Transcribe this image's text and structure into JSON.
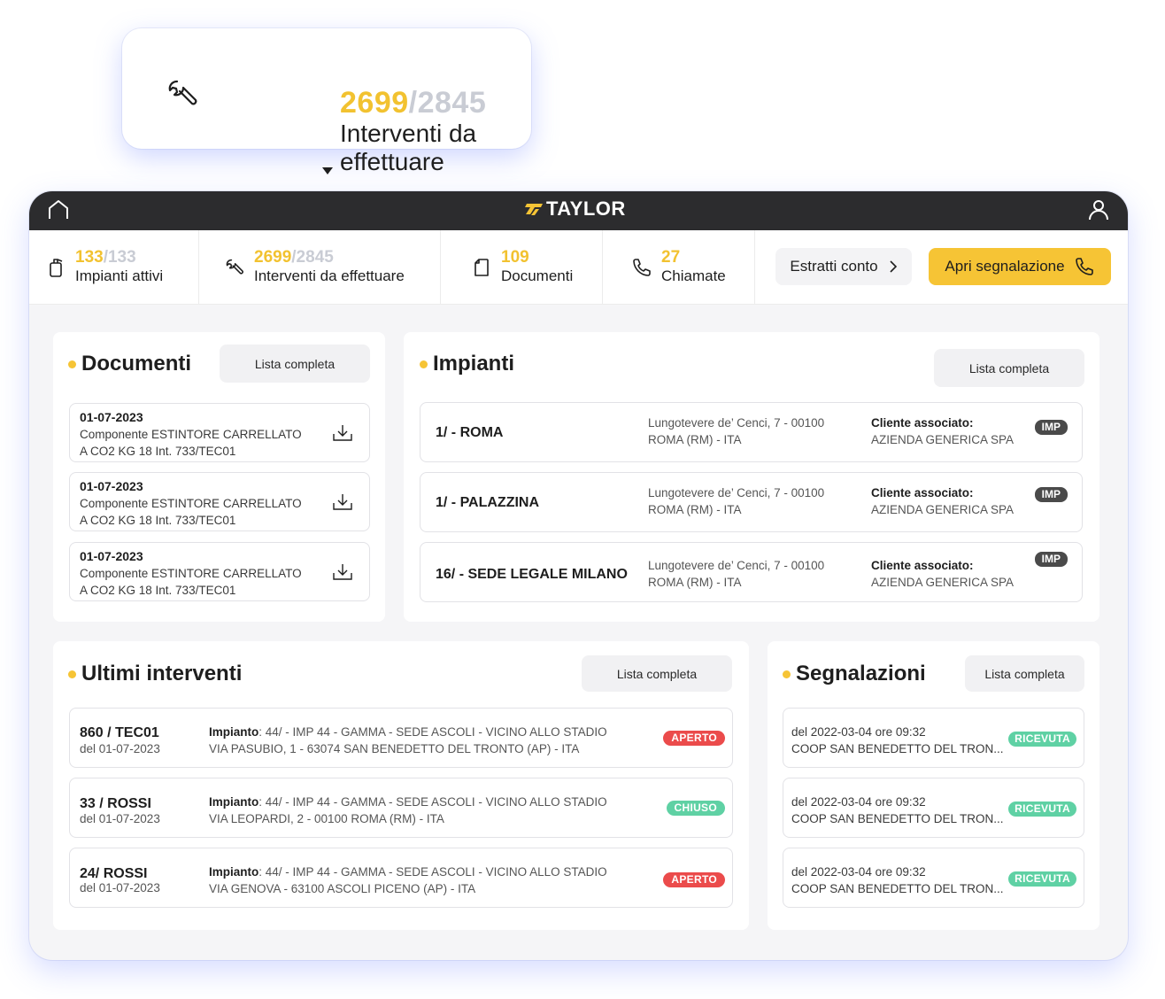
{
  "callout": {
    "num_done": "2699",
    "num_total": "/2845",
    "label": "Interventi da effettuare",
    "icon": "wrench-icon"
  },
  "brand": {
    "logo_text": "TAYLOR",
    "accent": "#f6c435",
    "dark": "#2c2c2e"
  },
  "stats": [
    {
      "num": "133",
      "total": "/133",
      "label": "Impianti attivi",
      "icon": "extinguisher-icon"
    },
    {
      "num": "2699",
      "total": "/2845",
      "label": "Interventi da effettuare",
      "icon": "wrench-icon"
    },
    {
      "num": "109",
      "total": "",
      "label": "Documenti",
      "icon": "document-icon"
    },
    {
      "num": "27",
      "total": "",
      "label": "Chiamate",
      "icon": "phone-icon"
    }
  ],
  "actions": {
    "estratti": "Estratti conto",
    "apri": "Apri segnalazione"
  },
  "documenti": {
    "title": "Documenti",
    "lista": "Lista completa",
    "items": [
      {
        "date": "01-07-2023",
        "desc": "Componente ESTINTORE CARRELLATO A CO2 KG 18 Int. 733/TEC01"
      },
      {
        "date": "01-07-2023",
        "desc": "Componente ESTINTORE CARRELLATO A CO2 KG 18 Int. 733/TEC01"
      },
      {
        "date": "01-07-2023",
        "desc": "Componente ESTINTORE CARRELLATO A CO2 KG 18 Int. 733/TEC01"
      }
    ]
  },
  "impianti": {
    "title": "Impianti",
    "lista": "Lista completa",
    "cliente_label": "Cliente associato:",
    "badge": "IMP",
    "items": [
      {
        "name": "1/ - ROMA",
        "addr1": "Lungotevere de’ Cenci, 7 - 00100",
        "addr2": "ROMA (RM) - ITA",
        "cliente": "AZIENDA GENERICA SPA"
      },
      {
        "name": "1/ - PALAZZINA",
        "addr1": "Lungotevere de’ Cenci, 7 - 00100",
        "addr2": "ROMA (RM) - ITA",
        "cliente": "AZIENDA GENERICA SPA"
      },
      {
        "name": "16/ - SEDE LEGALE MILANO",
        "addr1": "Lungotevere de’ Cenci, 7 - 00100",
        "addr2": "ROMA (RM) - ITA",
        "cliente": "AZIENDA GENERICA SPA"
      }
    ]
  },
  "interventi": {
    "title": "Ultimi interventi",
    "lista": "Lista completa",
    "impianto_label": "Impianto",
    "items": [
      {
        "code": "860 / TEC01",
        "date": "del 01-07-2023",
        "impianto": ": 44/ - IMP 44 - GAMMA - SEDE ASCOLI - VICINO ALLO STADIO",
        "addr": "VIA PASUBIO, 1 - 63074 SAN BENEDETTO DEL TRONTO (AP) - ITA",
        "status": "APERTO"
      },
      {
        "code": "33 / ROSSI",
        "date": "del 01-07-2023",
        "impianto": ": 44/ - IMP 44 - GAMMA - SEDE ASCOLI - VICINO ALLO STADIO",
        "addr": "VIA LEOPARDI, 2 - 00100 ROMA (RM) - ITA",
        "status": "CHIUSO"
      },
      {
        "code": "24/ ROSSI",
        "date": "del 01-07-2023",
        "impianto": ": 44/ - IMP 44 - GAMMA - SEDE ASCOLI - VICINO ALLO STADIO",
        "addr": "VIA GENOVA - 63100 ASCOLI PICENO (AP) - ITA",
        "status": "APERTO"
      }
    ]
  },
  "segnalazioni": {
    "title": "Segnalazioni",
    "lista": "Lista completa",
    "items": [
      {
        "when": "del 2022-03-04 ore 09:32",
        "who": "COOP SAN BENEDETTO DEL TRON...",
        "status": "RICEVUTA"
      },
      {
        "when": "del 2022-03-04 ore 09:32",
        "who": "COOP SAN BENEDETTO DEL TRON...",
        "status": "RICEVUTA"
      },
      {
        "when": "del 2022-03-04 ore 09:32",
        "who": "COOP SAN BENEDETTO DEL TRON...",
        "status": "RICEVUTA"
      }
    ]
  }
}
